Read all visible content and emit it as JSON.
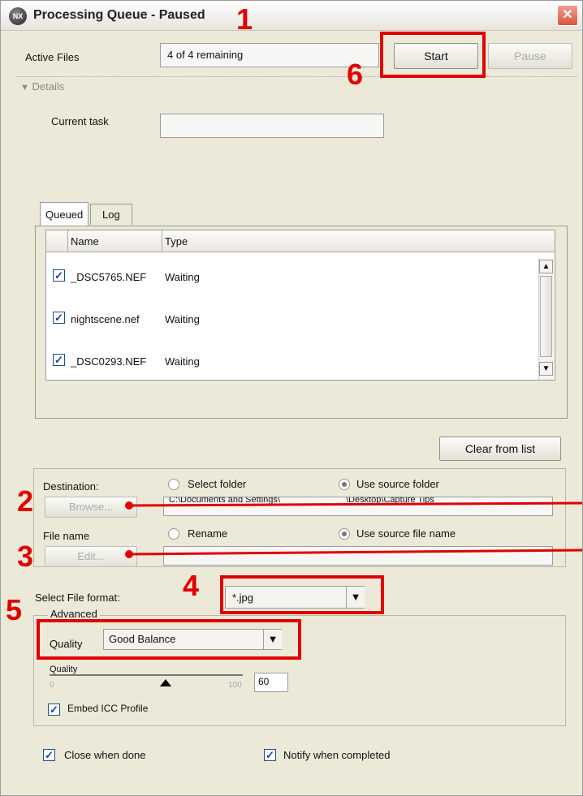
{
  "window": {
    "title": "Processing Queue - Paused",
    "app_icon_text": "NX",
    "close_icon": "close-icon"
  },
  "header": {
    "active_files_label": "Active Files",
    "active_files_value": "4 of 4 remaining",
    "start_label": "Start",
    "pause_label": "Pause"
  },
  "details": {
    "toggle_label": "Details",
    "current_task_label": "Current task",
    "current_task_value": ""
  },
  "tabs": [
    {
      "label": "Queued",
      "active": true
    },
    {
      "label": "Log",
      "active": false
    }
  ],
  "queue": {
    "columns": [
      "Name",
      "Type"
    ],
    "rows": [
      {
        "name": "_DSC5765.NEF",
        "type": "Waiting",
        "checked": true
      },
      {
        "name": "nightscene.nef",
        "type": "Waiting",
        "checked": true
      },
      {
        "name": "_DSC0293.NEF",
        "type": "Waiting",
        "checked": true
      }
    ]
  },
  "clear_from_list_label": "Clear from list",
  "destination": {
    "label": "Destination:",
    "select_folder_label": "Select folder",
    "use_source_folder_label": "Use source folder",
    "selected": "use_source_folder",
    "browse_label": "Browse...",
    "path_left": "C:\\Documents and Settings\\",
    "path_right": "\\Desktop\\Capture Tips"
  },
  "file_name": {
    "label": "File name",
    "rename_label": "Rename",
    "use_source_name_label": "Use source file name",
    "selected": "use_source_file_name",
    "edit_label": "Edit..."
  },
  "format": {
    "label": "Select File format:",
    "value": "*.jpg"
  },
  "advanced": {
    "legend": "Advanced",
    "quality_label": "Quality",
    "quality_value": "Good Balance",
    "slider_label": "Quality",
    "slider_min": "0",
    "slider_max": "100",
    "slider_value": "60",
    "slider_fraction": 0.6,
    "embed_icc_label": "Embed ICC Profile",
    "embed_icc_checked": true
  },
  "footer": {
    "close_when_done_label": "Close when done",
    "close_when_done_checked": true,
    "notify_label": "Notify when completed",
    "notify_checked": true
  },
  "annotations": {
    "n1": "1",
    "n2": "2",
    "n3": "3",
    "n4": "4",
    "n5": "5",
    "n6": "6",
    "color": "#e00000"
  }
}
